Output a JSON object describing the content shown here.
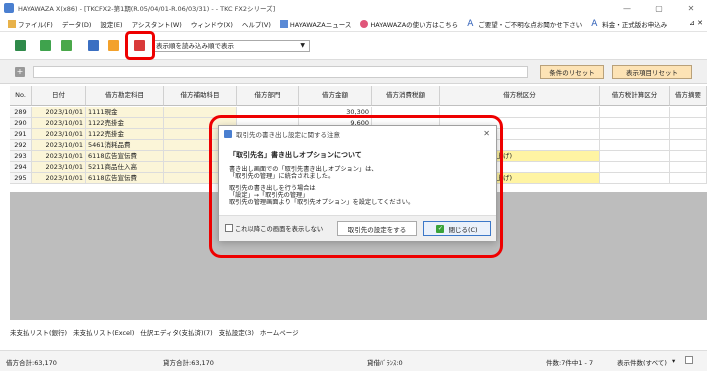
{
  "window": {
    "title": "HAYAWAZA X(x86) - [TKCFX2-第1期(R.05/04/01-R.06/03/31) - - TKC FX2シリーズ]",
    "controls": [
      "—",
      "▢",
      "✕"
    ]
  },
  "menu": {
    "items": [
      "ファイル(F)",
      "データ(D)",
      "設定(E)",
      "アシスタント(W)",
      "ウィンドウ(X)",
      "ヘルプ(V)",
      "HAYAWAZAニュース",
      "HAYAWAZAの使い方はこちら",
      "ご要望・ご不明な点お聞かせ下さい",
      "料金・正式版お申込み"
    ],
    "right": "⊿ ✕"
  },
  "toolbar": {
    "sort_value": "表示順を読み込み順で表示"
  },
  "filterbar": {
    "add": "+",
    "reset_conditions": "条件のリセット",
    "reset_columns": "表示項目リセット"
  },
  "grid": {
    "headers": [
      "No.",
      "日付",
      "借方勘定科目",
      "借方補助科目",
      "借方部門",
      "借方金額",
      "借方消費税額",
      "借方税区分",
      "借方税計算区分",
      "借方摘要"
    ],
    "rows": [
      [
        "289",
        "2023/10/01",
        "1111現金",
        "",
        "",
        "30,300",
        "",
        "",
        "",
        ""
      ],
      [
        "290",
        "2023/10/01",
        "1122売掛金",
        "",
        "",
        "9,600",
        "",
        "",
        "",
        ""
      ],
      [
        "291",
        "2023/10/01",
        "1122売掛金",
        "",
        "",
        "",
        "",
        "",
        "",
        ""
      ],
      [
        "292",
        "2023/10/01",
        "5461消耗品費",
        "",
        "",
        "",
        "",
        "する課税仕入れ",
        "",
        ""
      ],
      [
        "293",
        "2023/10/01",
        "6118広告宣伝費",
        "",
        "",
        "",
        "",
        "課税仕入れ(課税売上げ)",
        "",
        ""
      ],
      [
        "294",
        "2023/10/01",
        "5211商品仕入高",
        "",
        "",
        "",
        "",
        "する課税仕入れ",
        "",
        ""
      ],
      [
        "295",
        "2023/10/01",
        "6118広告宣伝費",
        "",
        "",
        "",
        "",
        "課税仕入れ(課税売上げ)",
        "",
        ""
      ]
    ]
  },
  "tabs": [
    "未支払リスト(銀行)",
    "未支払リスト(Excel)",
    "仕訳エディタ(支払済)(7)",
    "支払設定(3)",
    "ホームページ"
  ],
  "status": {
    "debit_total": "借方合計:63,170",
    "credit_total": "貸方合計:63,170",
    "balance": "貸借ﾊﾞﾗﾝｽ:0",
    "count": "件数:7件中1 - 7",
    "display_mode": "表示件数(すべて)",
    "dropdown": "▾"
  },
  "dialog": {
    "title": "取引先の書き出し設定に関する注意",
    "heading": "「取引先名」書き出しオプションについて",
    "lines1": [
      "書き出し画面での「取引先書き出しオプション」は、",
      "「取引先の管理」に統合されました。"
    ],
    "lines2": [
      "取引先の書き出しを行う場合は",
      "「設定」→「取引先の管理」",
      "取引先の管理画面より「取引先オプション」を設定してください。"
    ],
    "checkbox_label": "これ以降この画面を表示しない",
    "btn_settings": "取引先の設定をする",
    "btn_close": "閉じる(C)",
    "close_icon": "✕"
  },
  "colors": {
    "highlight": "#e00000",
    "button_orange": "#fde3b5",
    "row_yellow": "#fff4a3"
  }
}
